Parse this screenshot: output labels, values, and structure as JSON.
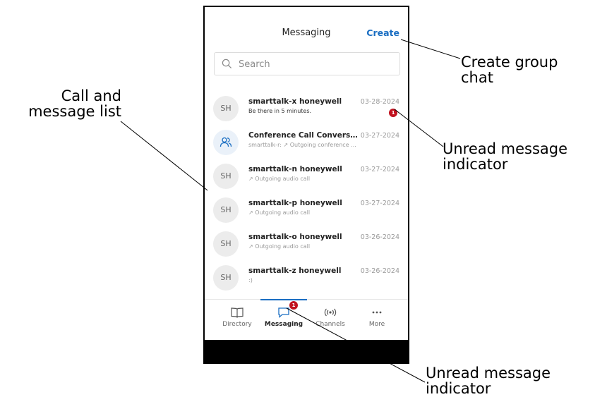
{
  "header": {
    "title": "Messaging",
    "create_label": "Create"
  },
  "search": {
    "placeholder": "Search"
  },
  "conversations": [
    {
      "avatar": "SH",
      "name": "smarttalk-x honeywell",
      "preview": "Be there in 5 minutes.",
      "date": "03-28-2024",
      "unread": "1"
    },
    {
      "avatar": "group-icon",
      "name": "Conference Call Conversati...",
      "preview": "smarttalk-r: ↗ Outgoing conference ...",
      "date": "03-27-2024"
    },
    {
      "avatar": "SH",
      "name": "smarttalk-n honeywell",
      "preview": "↗ Outgoing audio call",
      "date": "03-27-2024"
    },
    {
      "avatar": "SH",
      "name": "smarttalk-p honeywell",
      "preview": "↗ Outgoing audio call",
      "date": "03-27-2024"
    },
    {
      "avatar": "SH",
      "name": "smarttalk-o honeywell",
      "preview": "↗ Outgoing audio call",
      "date": "03-26-2024"
    },
    {
      "avatar": "SH",
      "name": "smarttalk-z honeywell",
      "preview": ":)",
      "date": "03-26-2024"
    }
  ],
  "bottom_nav": {
    "tabs": [
      {
        "label": "Directory",
        "icon": "book-icon"
      },
      {
        "label": "Messaging",
        "icon": "chat-icon",
        "active": true,
        "badge": "1"
      },
      {
        "label": "Channels",
        "icon": "broadcast-icon"
      },
      {
        "label": "More",
        "icon": "more-dots-icon"
      }
    ]
  },
  "callouts": {
    "create_group": "Create group chat",
    "list": "Call and message list",
    "unread_top": "Unread message indicator",
    "unread_bottom": "Unread message indicator"
  },
  "colors": {
    "accent": "#1a6ec2",
    "badge": "#c1121f"
  }
}
